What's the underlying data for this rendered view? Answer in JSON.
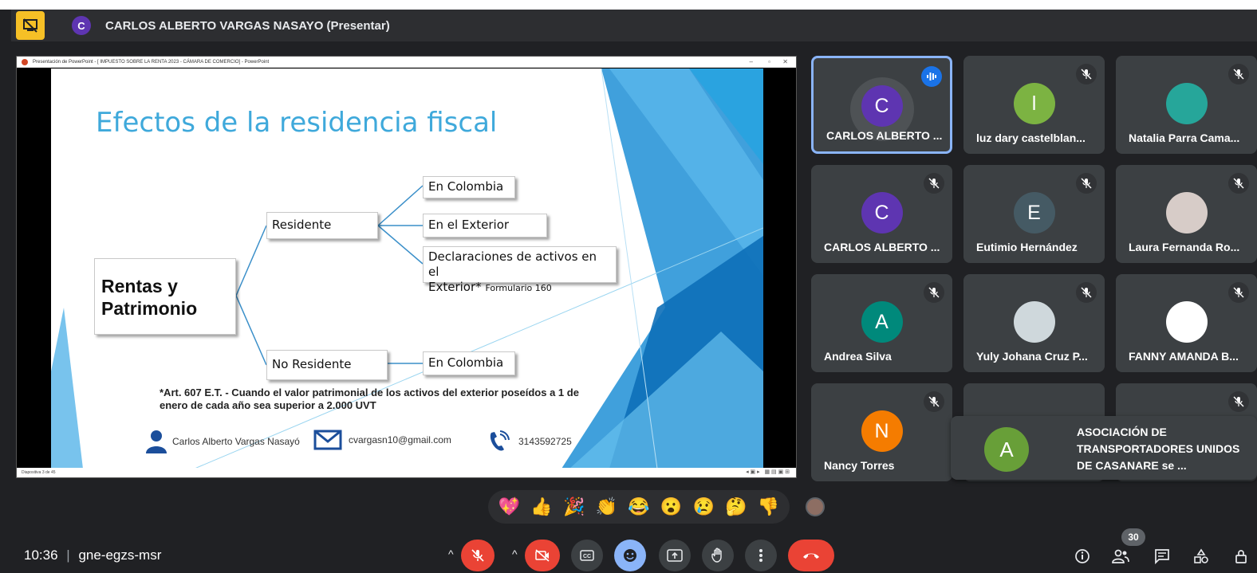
{
  "header": {
    "presenter_initial": "C",
    "presenter_label": "CARLOS ALBERTO VARGAS NASAYO (Presentar)"
  },
  "presentation": {
    "window_title": "Presentación de PowerPoint - [ IMPUESTO SOBRE LA RENTA 2023 - CÁMARA DE COMERCIO] - PowerPoint",
    "status_text": "Diapositiva 3 de 45",
    "slide": {
      "title": "Efectos de la residencia fiscal",
      "main_box": "Rentas y Patrimonio",
      "residente": "Residente",
      "no_residente": "No Residente",
      "branch_1": "En Colombia",
      "branch_2": "En el Exterior",
      "branch_3_line1": "Declaraciones de activos en el",
      "branch_3_line2": "Exterior*",
      "branch_3_small": "Formulario 160",
      "branch_4": "En Colombia",
      "footnote": "*Art. 607 E.T. - Cuando el valor patrimonial de los activos del exterior poseídos a 1 de enero de cada año sea superior a 2.000 UVT",
      "contact_name": "Carlos Alberto Vargas Nasayó",
      "contact_email": "cvargasn10@gmail.com",
      "contact_phone": "3143592725"
    }
  },
  "participants": [
    {
      "name": "CARLOS ALBERTO ...",
      "initial": "C",
      "color": "#5e35b1",
      "speaking": true
    },
    {
      "name": "luz dary castelblan...",
      "initial": "l",
      "color": "#7cb342",
      "speaking": false
    },
    {
      "name": "Natalia Parra Cama...",
      "initial": "",
      "color": "#26a69a",
      "speaking": false
    },
    {
      "name": "CARLOS ALBERTO ...",
      "initial": "C",
      "color": "#5e35b1",
      "speaking": false
    },
    {
      "name": "Eutimio Hernández",
      "initial": "E",
      "color": "#455a64",
      "speaking": false
    },
    {
      "name": "Laura Fernanda Ro...",
      "initial": "",
      "color": "#d7ccc8",
      "speaking": false
    },
    {
      "name": "Andrea Silva",
      "initial": "A",
      "color": "#00897b",
      "speaking": false
    },
    {
      "name": "Yuly Johana Cruz P...",
      "initial": "",
      "color": "#cfd8dc",
      "speaking": false
    },
    {
      "name": "FANNY AMANDA B...",
      "initial": "",
      "color": "#ffffff",
      "speaking": false
    },
    {
      "name": "Nancy Torres",
      "initial": "N",
      "color": "#f57c00",
      "speaking": false
    }
  ],
  "toast": {
    "initial": "A",
    "text": "ASOCIACIÓN DE TRANSPORTADORES UNIDOS DE CASANARE se ..."
  },
  "reactions": [
    "💖",
    "👍",
    "🎉",
    "👏",
    "😂",
    "😮",
    "😢",
    "🤔",
    "👎"
  ],
  "bottom": {
    "time": "10:36",
    "separator": "|",
    "meeting_code": "gne-egzs-msr",
    "participant_count": "30"
  }
}
